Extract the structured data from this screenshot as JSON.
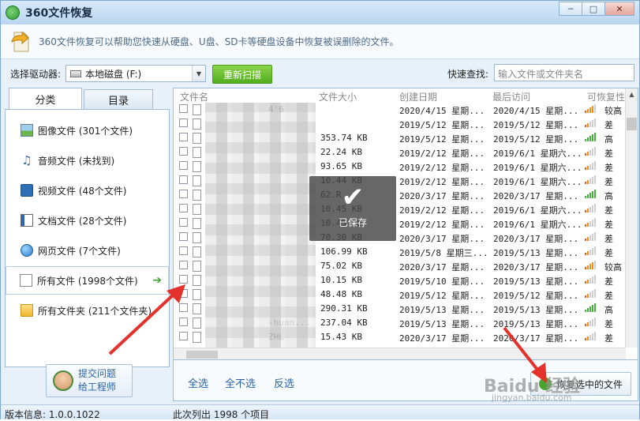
{
  "window": {
    "title": "360文件恢复",
    "min": "─",
    "max": "□",
    "close": "✕"
  },
  "info": {
    "text": "360文件恢复可以帮助您快速从硬盘、U盘、SD卡等硬盘设备中恢复被误删除的文件。"
  },
  "drive": {
    "label": "选择驱动器:",
    "selected": "本地磁盘 (F:)",
    "rescan": "重新扫描"
  },
  "search": {
    "label": "快速查找:",
    "placeholder": "输入文件或文件夹名"
  },
  "tabs": {
    "category": "分类",
    "directory": "目录"
  },
  "categories": [
    {
      "label": "图像文件 (301个文件)",
      "icon": "image-icon"
    },
    {
      "label": "音频文件 (未找到)",
      "icon": "music-icon"
    },
    {
      "label": "视频文件 (48个文件)",
      "icon": "video-icon"
    },
    {
      "label": "文档文件 (28个文件)",
      "icon": "document-icon"
    },
    {
      "label": "网页文件 (7个文件)",
      "icon": "webpage-icon"
    },
    {
      "label": "所有文件 (1998个文件)",
      "icon": "file-icon"
    },
    {
      "label": "所有文件夹 (211个文件夹)",
      "icon": "folder-icon"
    }
  ],
  "help": {
    "line1": "提交问题",
    "line2": "给工程师"
  },
  "table": {
    "headers": [
      "文件名",
      "文件大小",
      "创建日期",
      "最后访问",
      "可恢复性"
    ],
    "rows": [
      {
        "name": "4'6",
        "size": "",
        "created": "2020/4/15 星期...",
        "accessed": "2020/4/15 星期...",
        "recover": "较高",
        "level": 3
      },
      {
        "name": "",
        "size": "",
        "created": "2019/5/12 星期...",
        "accessed": "2019/5/12 星期...",
        "recover": "差",
        "level": 1
      },
      {
        "name": "",
        "size": "353.74 KB",
        "created": "2019/5/12 星期...",
        "accessed": "2019/5/12 星期...",
        "recover": "高",
        "level": 4
      },
      {
        "name": "",
        "size": "22.24 KB",
        "created": "2019/2/12 星期...",
        "accessed": "2019/6/1 星期六...",
        "recover": "差",
        "level": 1
      },
      {
        "name": "",
        "size": "93.65 KB",
        "created": "2019/2/12 星期...",
        "accessed": "2019/6/1 星期六...",
        "recover": "差",
        "level": 1
      },
      {
        "name": "",
        "size": "10.44 KB",
        "created": "2019/2/12 星期...",
        "accessed": "2019/6/1 星期六...",
        "recover": "差",
        "level": 1
      },
      {
        "name": "",
        "size": "62.R",
        "created": "2020/3/17 星期...",
        "accessed": "2020/3/17 星期...",
        "recover": "高",
        "level": 4
      },
      {
        "name": "",
        "size": "10.45 KB",
        "created": "2019/2/12 星期...",
        "accessed": "2019/6/1 星期六...",
        "recover": "差",
        "level": 1
      },
      {
        "name": "",
        "size": "10.45 KB",
        "created": "2019/2/12 星期...",
        "accessed": "2019/6/1 星期六...",
        "recover": "差",
        "level": 1
      },
      {
        "name": "",
        "size": "70.30 KB",
        "created": "2020/3/17 星期...",
        "accessed": "2020/3/17 星期...",
        "recover": "差",
        "level": 1
      },
      {
        "name": "",
        "size": "106.99 KB",
        "created": "2019/5/8 星期三...",
        "accessed": "2019/5/13 星期...",
        "recover": "差",
        "level": 1
      },
      {
        "name": "",
        "size": "75.02 KB",
        "created": "2020/3/17 星期...",
        "accessed": "2020/3/17 星期...",
        "recover": "较高",
        "level": 3
      },
      {
        "name": "",
        "size": "10.15 KB",
        "created": "2019/5/10 星期...",
        "accessed": "2019/5/13 星期...",
        "recover": "差",
        "level": 1
      },
      {
        "name": "",
        "size": "48.48 KB",
        "created": "2019/5/12 星期...",
        "accessed": "2019/5/12 星期...",
        "recover": "差",
        "level": 1
      },
      {
        "name": "",
        "size": "290.31 KB",
        "created": "2019/5/13 星期...",
        "accessed": "2019/5/13 星期...",
        "recover": "高",
        "level": 4
      },
      {
        "name": "-huan...",
        "size": "237.04 KB",
        "created": "2019/5/13 星期...",
        "accessed": "2019/5/13 星期...",
        "recover": "差",
        "level": 1
      },
      {
        "name": "ZHL",
        "size": "15.43 KB",
        "created": "2020/3/17 星期...",
        "accessed": "2020/3/17 星期...",
        "recover": "差",
        "level": 1
      }
    ]
  },
  "saved_overlay": {
    "text": "已保存"
  },
  "actions": {
    "select_all": "全选",
    "select_none": "全不选",
    "invert": "反选",
    "recover": "恢复选中的文件"
  },
  "status": {
    "version": "版本信息: 1.0.0.1022",
    "count": "此次列出 1998 个项目"
  },
  "watermark": {
    "line1": "Baidu 经验",
    "line2": "jingyan.baidu.com"
  },
  "colors": {
    "accent_green": "#52ad1f",
    "annotation_red": "#e3322b",
    "link_blue": "#2a64a5"
  }
}
